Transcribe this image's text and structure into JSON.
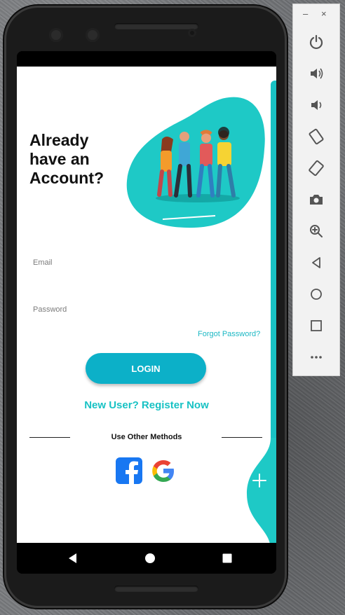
{
  "app": {
    "title_lines": [
      "Already",
      "have an",
      "Account?"
    ],
    "email_label": "Email",
    "password_label": "Password",
    "forgot_password": "Forgot Password?",
    "login_button": "LOGIN",
    "register_link": "New User? Register Now",
    "other_methods": "Use Other Methods",
    "social": [
      "facebook-icon",
      "google-icon"
    ],
    "fab": "plus-icon"
  },
  "colors": {
    "accent": "#18c2c4",
    "login_button": "#0cb0c8",
    "facebook": "#1877f2"
  },
  "nav_bar": [
    "back-icon",
    "home-icon",
    "recents-icon"
  ],
  "emulator_toolbar": {
    "window_controls": [
      "minimize-icon",
      "close-icon"
    ],
    "buttons": [
      "power-icon",
      "volume-up-icon",
      "volume-down-icon",
      "rotate-left-icon",
      "rotate-right-icon",
      "camera-icon",
      "zoom-icon",
      "back-icon",
      "home-icon",
      "overview-icon",
      "more-icon"
    ]
  }
}
